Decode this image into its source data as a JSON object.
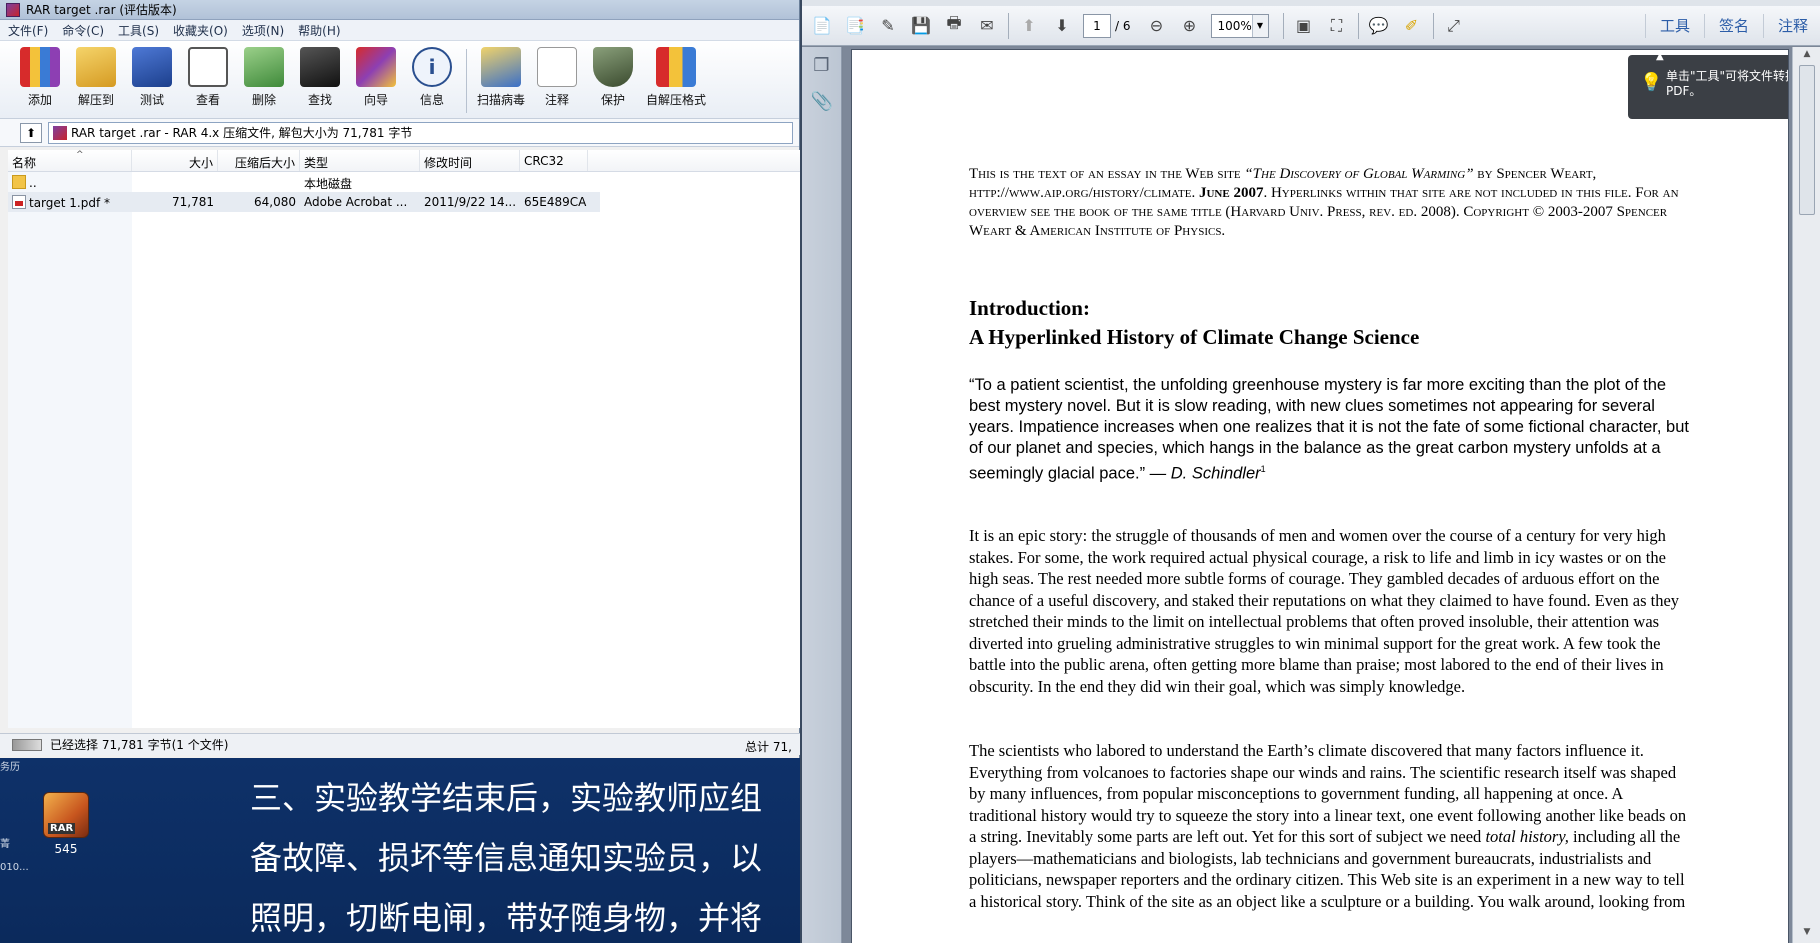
{
  "winrar": {
    "title": "RAR target .rar (评估版本)",
    "menu": [
      "文件(F)",
      "命令(C)",
      "工具(S)",
      "收藏夹(O)",
      "选项(N)",
      "帮助(H)"
    ],
    "toolbar": [
      "添加",
      "解压到",
      "测试",
      "查看",
      "删除",
      "查找",
      "向导",
      "信息",
      "扫描病毒",
      "注释",
      "保护",
      "自解压格式"
    ],
    "address": "RAR target .rar - RAR 4.x 压缩文件, 解包大小为 71,781 字节",
    "columns": {
      "name": "名称",
      "size": "大小",
      "packed": "压缩后大小",
      "type": "类型",
      "modified": "修改时间",
      "crc": "CRC32"
    },
    "rows": [
      {
        "name": "..",
        "size": "",
        "packed": "",
        "type": "本地磁盘",
        "modified": "",
        "crc": ""
      },
      {
        "name": "target 1.pdf *",
        "size": "71,781",
        "packed": "64,080",
        "type": "Adobe Acrobat ...",
        "modified": "2011/9/22 14...",
        "crc": "65E489CA"
      }
    ],
    "status_left": "已经选择 71,781 字节(1 个文件)",
    "status_right": "总计 71,"
  },
  "desktop": {
    "lines": [
      "三、实验教学结束后，实验教师应组",
      "备故障、损坏等信息通知实验员，以",
      "照明，切断电闸，带好随身物，并将"
    ],
    "icon_label": "545",
    "icon_badge": "RAR",
    "left_snippets": [
      "务历",
      "菁",
      "010..."
    ]
  },
  "acrobat": {
    "page_current": "1",
    "page_total": "/ 6",
    "zoom": "100%",
    "right_menu": [
      "工具",
      "签名",
      "注释"
    ],
    "tooltip": "单击\"工具\"可将文件转换为PDF。",
    "doc": {
      "header_parts": {
        "a": "This is the text of an essay in the Web site ",
        "b": "“The Discovery of Global Warming”",
        "c": " by Spencer Weart, http://www.aip.org/history/climate. ",
        "d": "June 2007",
        "e": ". Hyperlinks within that site are not included in this file.  For an overview see the book of the same title (Harvard Univ. Press, rev. ed. 2008).  Copyright © 2003-2007 Spencer Weart & American Institute of Physics."
      },
      "title_line1": "Introduction:",
      "title_line2": "A Hyperlinked History of Climate Change Science",
      "quote": "“To a patient scientist, the unfolding greenhouse mystery is far more exciting than the plot of the best mystery novel. But it is slow reading, with new clues sometimes not appearing for several years. Impatience increases when one realizes that it is not the fate of some fictional character, but of our planet and species, which hangs in the balance as the great carbon mystery unfolds at a seemingly glacial pace.” ",
      "quote_author": "— D. Schindler",
      "quote_sup": "1",
      "para1": "It is an epic story: the struggle of thousands of men and women over the course of a century for very high stakes. For some, the work required actual physical courage, a risk to life and limb in icy wastes or on the high seas. The rest needed more subtle forms of courage. They gambled decades of arduous effort on the chance of a useful discovery, and staked their reputations on what they claimed to have found. Even as they stretched their minds to the limit on intellectual problems that often proved insoluble, their attention was diverted into grueling administrative struggles to win minimal support for the great work. A few took the battle into the public arena, often getting more blame than praise; most labored to the end of their lives in obscurity. In the end they did win their goal, which was simply knowledge.",
      "para2_a": "The scientists who labored to understand the Earth’s climate discovered that many factors influence it. Everything from volcanoes to factories shape our winds and rains. The scientific research itself was shaped by many influences, from popular misconceptions to government funding, all happening at once. A traditional history would try to squeeze the story into a linear text, one event following another like beads on a string. Inevitably some parts are left out. Yet for this sort of subject we need ",
      "para2_em": "total history,",
      "para2_b": " including all the players—mathematicians and biologists, lab technicians and government bureaucrats, industrialists and politicians, newspaper reporters and the ordinary citizen. This Web site is an experiment in a new way to tell a historical story. Think of the site as an object like a sculpture or a building. You walk around, looking from"
    }
  }
}
